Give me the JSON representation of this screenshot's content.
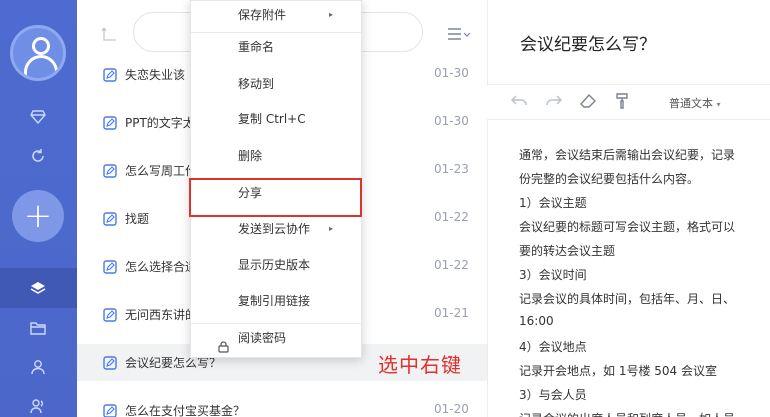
{
  "context_menu": {
    "items": [
      {
        "label": "保存附件",
        "submenu": true
      },
      {
        "label": "重命名",
        "submenu": false
      },
      {
        "label": "移动到",
        "submenu": false
      },
      {
        "label": "复制 Ctrl+C",
        "submenu": false
      },
      {
        "label": "删除",
        "submenu": false
      },
      {
        "label": "分享",
        "submenu": false,
        "highlighted": true
      },
      {
        "label": "发送到云协作",
        "submenu": true
      },
      {
        "label": "显示历史版本",
        "submenu": false
      },
      {
        "label": "复制引用链接",
        "submenu": false
      },
      {
        "label": "阅读密码",
        "submenu": false,
        "icon": "lock-icon"
      }
    ],
    "submenu_arrow": "▸"
  },
  "notes": [
    {
      "title": "失恋失业该",
      "date": "01-30"
    },
    {
      "title": "PPT的文字太",
      "date": "01-30"
    },
    {
      "title": "怎么写周工作",
      "date": "01-23"
    },
    {
      "title": "找题",
      "date": "01-22"
    },
    {
      "title": "怎么选择合适",
      "date": "01-22"
    },
    {
      "title": "无问西东讲的",
      "date": "01-21"
    },
    {
      "title": "会议纪要怎么写？",
      "date": "",
      "selected": true
    },
    {
      "title": "怎么在支付宝买基金？",
      "date": "01-20"
    }
  ],
  "editor": {
    "title": "会议纪要怎么写？",
    "font_style": "普通文本",
    "lines": [
      "通常，会议结束后需输出会议纪要，记录",
      "份完整的会议纪要包括什么内容。",
      "1）会议主题",
      "会议纪要的标题可写会议主题，格式可以",
      "要的转达会议主题",
      "3）会议时间",
      "记录会议的具体时间，包括年、月、日、",
      "16:00",
      "4）会议地点",
      "记录开会地点，如 1号楼 504 会议室",
      "3）与会人员",
      "记录会议的出席人员和列席人员，如人员"
    ]
  },
  "annotation": "选中右键",
  "colors": {
    "sidebar": "#4d6bd0",
    "highlight": "#e0322d",
    "note_icon": "#4a7be6"
  }
}
